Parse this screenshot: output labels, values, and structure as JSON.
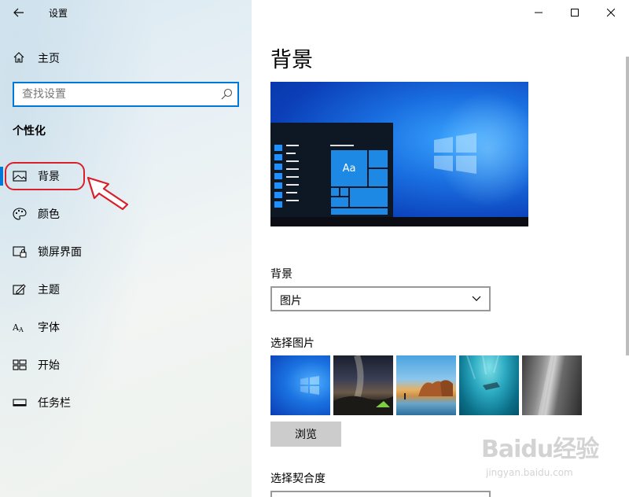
{
  "window": {
    "title": "设置",
    "minimize_icon": "minimize-icon",
    "maximize_icon": "maximize-icon",
    "close_icon": "close-icon"
  },
  "sidebar": {
    "home_label": "主页",
    "search_placeholder": "查找设置",
    "section_title": "个性化",
    "items": [
      {
        "label": "背景",
        "icon": "picture-icon",
        "active": true
      },
      {
        "label": "颜色",
        "icon": "palette-icon"
      },
      {
        "label": "锁屏界面",
        "icon": "lock-screen-icon"
      },
      {
        "label": "主题",
        "icon": "theme-brush-icon"
      },
      {
        "label": "字体",
        "icon": "font-icon"
      },
      {
        "label": "开始",
        "icon": "start-grid-icon"
      },
      {
        "label": "任务栏",
        "icon": "taskbar-icon"
      }
    ]
  },
  "main": {
    "page_title": "背景",
    "preview_tile_text": "Aa",
    "background_label": "背景",
    "background_value": "图片",
    "choose_picture_label": "选择图片",
    "browse_label": "浏览",
    "fit_label": "选择契合度"
  },
  "watermark": {
    "brand": "Baidu经验",
    "url": "jingyan.baidu.com"
  },
  "colors": {
    "accent": "#0078d7",
    "annotation_red": "#d9202a"
  }
}
